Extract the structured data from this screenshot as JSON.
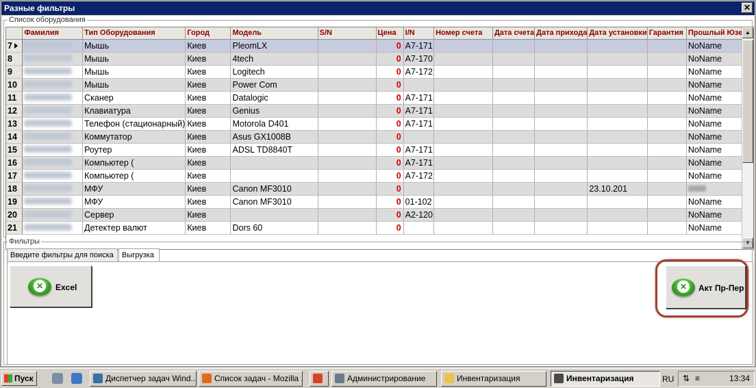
{
  "window": {
    "title": "Разные фильтры",
    "close_glyph": "✕"
  },
  "equipment_group": {
    "label": "Список оборудования"
  },
  "grid": {
    "columns": [
      "",
      "Фамилия",
      "Тип Оборудования",
      "Город",
      "Модель",
      "S/N",
      "Цена",
      "I/N",
      "Номер счета",
      "Дата счета",
      "Дата прихода",
      "Дата установки",
      "Гарантия",
      "Прошлый Юзер"
    ],
    "rows": [
      {
        "n": "7",
        "type": "Мышь",
        "city": "Киев",
        "model": "PleomLX",
        "price": "0",
        "inv": "A7-171",
        "date_inst": "",
        "prev_user": "NoName",
        "selected": true
      },
      {
        "n": "8",
        "type": "Мышь",
        "city": "Киев",
        "model": "4tech",
        "price": "0",
        "inv": "A7-170",
        "date_inst": "",
        "prev_user": "NoName"
      },
      {
        "n": "9",
        "type": "Мышь",
        "city": "Киев",
        "model": "Logitech",
        "price": "0",
        "inv": "A7-172",
        "date_inst": "",
        "prev_user": "NoName"
      },
      {
        "n": "10",
        "type": "Мышь",
        "city": "Киев",
        "model": "Power Com",
        "price": "0",
        "inv": "",
        "date_inst": "",
        "prev_user": "NoName"
      },
      {
        "n": "11",
        "type": "Сканер",
        "city": "Киев",
        "model": "Datalogic",
        "price": "0",
        "inv": "A7-171",
        "date_inst": "",
        "prev_user": "NoName"
      },
      {
        "n": "12",
        "type": "Клавиатура",
        "city": "Киев",
        "model": "Genius",
        "price": "0",
        "inv": "A7-171",
        "date_inst": "",
        "prev_user": "NoName"
      },
      {
        "n": "13",
        "type": "Телефон (стационарный)",
        "city": "Киев",
        "model": "Motorola D401",
        "price": "0",
        "inv": "A7-171",
        "date_inst": "",
        "prev_user": "NoName"
      },
      {
        "n": "14",
        "type": "Коммутатор",
        "city": "Киев",
        "model": "Asus GX1008B",
        "price": "0",
        "inv": "",
        "date_inst": "",
        "prev_user": "NoName"
      },
      {
        "n": "15",
        "type": "Роутер",
        "city": "Киев",
        "model": "ADSL TD8840T",
        "price": "0",
        "inv": "A7-171",
        "date_inst": "",
        "prev_user": "NoName"
      },
      {
        "n": "16",
        "type": "Компьютер (",
        "city": "Киев",
        "model": "",
        "price": "0",
        "inv": "A7-171",
        "date_inst": "",
        "prev_user": "NoName"
      },
      {
        "n": "17",
        "type": "Компьютер (",
        "city": "Киев",
        "model": "",
        "price": "0",
        "inv": "A7-172",
        "date_inst": "",
        "prev_user": "NoName"
      },
      {
        "n": "18",
        "type": "МФУ",
        "city": "Киев",
        "model": "Canon MF3010",
        "price": "0",
        "inv": "",
        "date_inst": "23.10.201",
        "prev_user": "",
        "prev_user_blurred": true
      },
      {
        "n": "19",
        "type": "МФУ",
        "city": "Киев",
        "model": "Canon MF3010",
        "price": "0",
        "inv": "01-102",
        "date_inst": "",
        "prev_user": "NoName"
      },
      {
        "n": "20",
        "type": "Сервер",
        "city": "Киев",
        "model": "",
        "price": "0",
        "inv": "A2-120",
        "date_inst": "",
        "prev_user": "NoName"
      },
      {
        "n": "21",
        "type": "Детектер валют",
        "city": "Киев",
        "model": "Dors 60",
        "price": "0",
        "inv": "",
        "date_inst": "",
        "prev_user": "NoName"
      }
    ]
  },
  "filters_group": {
    "label": "Фильтры"
  },
  "tabs": [
    "Введите фильтры для поиска",
    "Выгрузка"
  ],
  "buttons": {
    "excel": "Excel",
    "act": "Акт Пр-Пер",
    "icon_glyph": "✕"
  },
  "taskbar": {
    "start": "Пуск",
    "items": [
      {
        "label": "Диспетчер задач Wind...",
        "icon_color": "#3a6ea5"
      },
      {
        "label": "Список задач - Mozilla ...",
        "icon_color": "#e06a1c"
      },
      {
        "label": "",
        "icon_color": "#d9412a"
      },
      {
        "label": "Администрирование",
        "icon_color": "#6a7a8a"
      },
      {
        "label": "Инвентаризация",
        "icon_color": "#e8c34a"
      },
      {
        "label": "Инвентаризация",
        "icon_color": "#4a4a4a",
        "active": true
      }
    ],
    "lang": "RU",
    "clock": "13:34"
  }
}
